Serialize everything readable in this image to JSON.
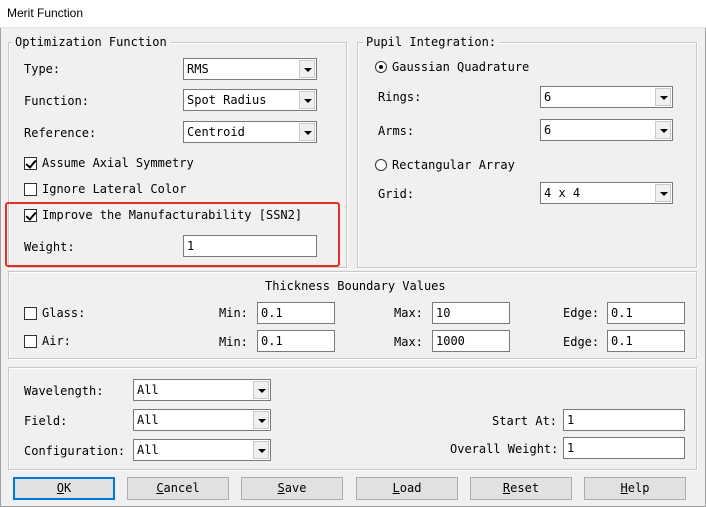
{
  "window": {
    "title": "Merit Function"
  },
  "optimization_function": {
    "legend": "Optimization Function",
    "type_label": "Type:",
    "type_value": "RMS",
    "function_label": "Function:",
    "function_value": "Spot Radius",
    "reference_label": "Reference:",
    "reference_value": "Centroid",
    "assume_axial_symmetry": {
      "label": "Assume Axial Symmetry",
      "checked": true
    },
    "ignore_lateral_color": {
      "label": "Ignore Lateral Color",
      "checked": false
    },
    "improve_manufacturability": {
      "label": "Improve the Manufacturability [SSN2]",
      "checked": true
    },
    "weight_label": "Weight:",
    "weight_value": "1",
    "highlight_color": "#e0302a"
  },
  "pupil_integration": {
    "legend": "Pupil Integration:",
    "gaussian_label": "Gaussian Quadrature",
    "gaussian_selected": true,
    "rings_label": "Rings:",
    "rings_value": "6",
    "arms_label": "Arms:",
    "arms_value": "6",
    "rectangular_label": "Rectangular Array",
    "rectangular_selected": false,
    "grid_label": "Grid:",
    "grid_value": "4 x 4"
  },
  "thickness": {
    "title": "Thickness Boundary Values",
    "glass_label": "Glass:",
    "glass_checked": false,
    "air_label": "Air:",
    "air_checked": false,
    "min_label": "Min:",
    "max_label": "Max:",
    "edge_label": "Edge:",
    "glass_min": "0.1",
    "glass_max": "10",
    "glass_edge": "0.1",
    "air_min": "0.1",
    "air_max": "1000",
    "air_edge": "0.1"
  },
  "settings": {
    "wavelength_label": "Wavelength:",
    "wavelength_value": "All",
    "field_label": "Field:",
    "field_value": "All",
    "configuration_label": "Configuration:",
    "configuration_value": "All",
    "start_at_label": "Start At:",
    "start_at_value": "1",
    "overall_weight_label": "Overall Weight:",
    "overall_weight_value": "1"
  },
  "buttons": {
    "ok_first": "O",
    "ok_rest": "K",
    "cancel_first": "C",
    "cancel_rest": "ancel",
    "save_first": "S",
    "save_rest": "ave",
    "load_first": "L",
    "load_rest": "oad",
    "reset_first": "R",
    "reset_rest": "eset",
    "help_first": "H",
    "help_rest": "elp"
  }
}
